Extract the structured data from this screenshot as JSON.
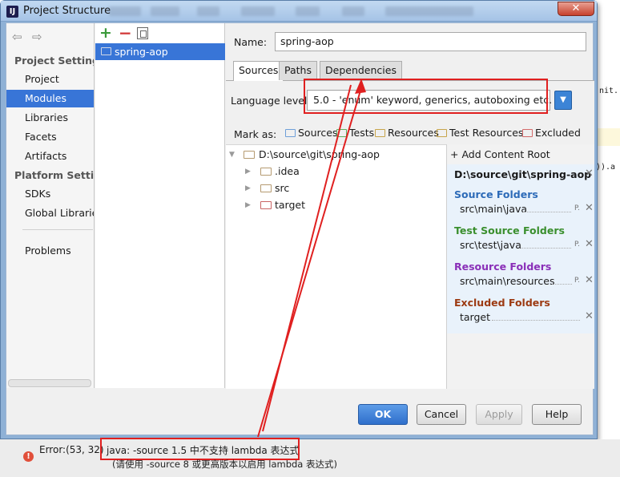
{
  "window": {
    "title": "Project Structure",
    "icon_letters": "IJ",
    "close_label": "✕"
  },
  "nav": {
    "back_icon": "⇦",
    "forward_icon": "⇨",
    "project_settings_header": "Project Settings",
    "project_items": [
      "Project",
      "Modules",
      "Libraries",
      "Facets",
      "Artifacts"
    ],
    "selected_item": "Modules",
    "platform_settings_header": "Platform Settings",
    "platform_items": [
      "SDKs",
      "Global Libraries"
    ],
    "problems_label": "Problems"
  },
  "modules": {
    "items": [
      "spring-aop"
    ]
  },
  "editor": {
    "name_label": "Name:",
    "name_value": "spring-aop",
    "tabs": [
      "Sources",
      "Paths",
      "Dependencies"
    ],
    "active_tab": "Sources",
    "language_level_label": "Language level:",
    "language_level_value": "5.0 - 'enum' keyword, generics, autoboxing etc.",
    "mark_as_label": "Mark as:",
    "mark_as_buttons": [
      {
        "label": "Sources",
        "color": "#6e9fd8"
      },
      {
        "label": "Tests",
        "color": "#5eb05e"
      },
      {
        "label": "Resources",
        "color": "#c7a44a"
      },
      {
        "label": "Test Resources",
        "color": "#c7a44a"
      },
      {
        "label": "Excluded",
        "color": "#d36a6a"
      }
    ]
  },
  "tree": {
    "root": "D:\\source\\git\\spring-aop",
    "children": [
      {
        "label": ".idea",
        "color": "#b59a70"
      },
      {
        "label": "src",
        "color": "#b59a70"
      },
      {
        "label": "target",
        "color": "#c96464"
      }
    ]
  },
  "content_root": {
    "add_label": "+ Add Content Root",
    "path": "D:\\source\\git\\spring-aop",
    "sections": [
      {
        "header": "Source Folders",
        "color": "#2d6bb8",
        "path": "src\\main\\java"
      },
      {
        "header": "Test Source Folders",
        "color": "#3a8f2e",
        "path": "src\\test\\java"
      },
      {
        "header": "Resource Folders",
        "color": "#8a2fb8",
        "path": "src\\main\\resources"
      },
      {
        "header": "Excluded Folders",
        "color": "#9c3a12",
        "path": "target"
      }
    ],
    "p_label": "P.",
    "remove_icon": "✕"
  },
  "buttons": {
    "ok": "OK",
    "cancel": "Cancel",
    "apply": "Apply",
    "help": "Help"
  },
  "status": {
    "error_label": "Error:(53, 32)",
    "error_message": "java: -source 1.5 中不支持 lambda 表达式",
    "error_hint": "(请使用 -source 8 或更高版本以启用 lambda 表达式)"
  },
  "ide_bg": {
    "line1": "nit.",
    "line2": ")).a"
  },
  "colors": {
    "selection": "#3875d7",
    "annotation_red": "#e02020"
  }
}
